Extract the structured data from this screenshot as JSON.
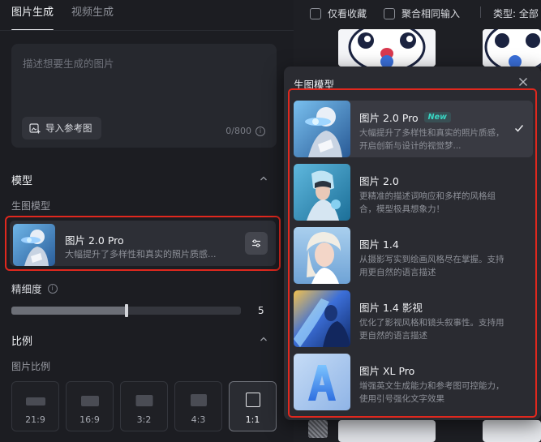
{
  "tabs": [
    {
      "label": "图片生成",
      "active": true
    },
    {
      "label": "视频生成",
      "active": false
    }
  ],
  "prompt": {
    "placeholder": "描述想要生成的图片",
    "ref_button": "导入参考图",
    "count": "0/800"
  },
  "model_section": {
    "title": "模型",
    "sub_label": "生图模型",
    "selected": {
      "name": "图片 2.0 Pro",
      "desc": "大幅提升了多样性和真实的照片质感..."
    }
  },
  "precision": {
    "label": "精细度",
    "value": "5",
    "fraction": 0.5
  },
  "ratio_section": {
    "title": "比例",
    "sub_label": "图片比例",
    "options": [
      {
        "label": "21:9",
        "active": false
      },
      {
        "label": "16:9",
        "active": false
      },
      {
        "label": "3:2",
        "active": false
      },
      {
        "label": "4:3",
        "active": false
      },
      {
        "label": "1:1",
        "active": true
      }
    ]
  },
  "filter_bar": {
    "favorites_only": "仅看收藏",
    "merge_same_input": "聚合相同输入",
    "type_label": "类型: 全部"
  },
  "popup": {
    "title": "生图模型",
    "models": [
      {
        "name": "图片 2.0 Pro",
        "badge": "New",
        "desc": "大幅提升了多样性和真实的照片质感，开启创新与设计的视觉梦...",
        "selected": true
      },
      {
        "name": "图片 2.0",
        "badge": "",
        "desc": "更精准的描述词响应和多样的风格组合，模型极具想象力！",
        "selected": false
      },
      {
        "name": "图片 1.4",
        "badge": "",
        "desc": "从摄影写实到绘画风格尽在掌握。支持用更自然的语言描述",
        "selected": false
      },
      {
        "name": "图片 1.4 影视",
        "badge": "",
        "desc": "优化了影视风格和镜头叙事性。支持用更自然的语言描述",
        "selected": false
      },
      {
        "name": "图片 XL Pro",
        "badge": "",
        "desc": "增强英文生成能力和参考图可控能力，使用引号强化文字效果",
        "selected": false
      }
    ]
  },
  "colors": {
    "accent_red": "#e0281e",
    "badge_teal": "#39d6c4"
  }
}
